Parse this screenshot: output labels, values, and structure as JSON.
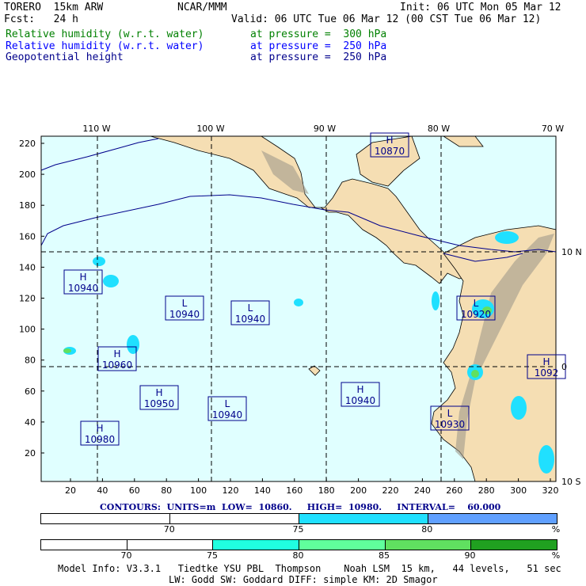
{
  "header": {
    "model": "TORERO  15km ARW",
    "org": "NCAR/MMM",
    "init": "Init: 06 UTC Mon 05 Mar 12",
    "fcst": "Fcst:   24 h",
    "valid": "Valid: 06 UTC Tue 06 Mar 12 (00 CST Tue 06 Mar 12)",
    "fields": [
      {
        "name": "Relative humidity (w.r.t. water)",
        "level": "at pressure =  300 hPa",
        "color": "#008000"
      },
      {
        "name": "Relative humidity (w.r.t. water)",
        "level": "at pressure =  250 hPa",
        "color": "#0000ff"
      },
      {
        "name": "Geopotential height",
        "level": "at pressure =  250 hPa",
        "color": "#00008b"
      }
    ]
  },
  "map": {
    "top_lon_labels": [
      "110 W",
      "100 W",
      "90 W",
      "80 W",
      "70 W"
    ],
    "right_lat_labels": [
      "10 N",
      "0",
      "10 S"
    ],
    "y_ticks": [
      "220",
      "200",
      "180",
      "160",
      "140",
      "120",
      "100",
      "80",
      "60",
      "40",
      "20"
    ],
    "x_ticks": [
      "20",
      "40",
      "60",
      "80",
      "100",
      "120",
      "140",
      "160",
      "180",
      "200",
      "220",
      "240",
      "260",
      "280",
      "300",
      "320"
    ],
    "centers": [
      {
        "type": "H",
        "value": "10940"
      },
      {
        "type": "L",
        "value": "10940"
      },
      {
        "type": "L",
        "value": "10940"
      },
      {
        "type": "H",
        "value": "10960"
      },
      {
        "type": "H",
        "value": "10950"
      },
      {
        "type": "L",
        "value": "10940"
      },
      {
        "type": "H",
        "value": "10940"
      },
      {
        "type": "H",
        "value": "10980"
      },
      {
        "type": "L",
        "value": "10930"
      },
      {
        "type": "L",
        "value": "10920"
      },
      {
        "type": "H",
        "value": "10870"
      },
      {
        "type": "H",
        "value": "1092"
      }
    ],
    "colors": {
      "ocean": "#e0ffff",
      "land": "#f5deb3",
      "contour": "#00008b"
    }
  },
  "contours_info": {
    "label": "CONTOURS:  UNITS=m  LOW=  10860.     HIGH=  10980.     INTERVAL=    60.000"
  },
  "colorbar1": {
    "ticks": [
      "70",
      "75",
      "80",
      "%"
    ],
    "colors": [
      "#ffffff",
      "#ffffff",
      "#20e0ff",
      "#60a0ff"
    ]
  },
  "colorbar2": {
    "ticks": [
      "70",
      "75",
      "80",
      "85",
      "90",
      "%"
    ],
    "colors": [
      "#ffffff",
      "#ffffff",
      "#20ffe0",
      "#60ff9c",
      "#60e060",
      "#20a020"
    ]
  },
  "footer": {
    "line1": "Model Info: V3.3.1   Tiedtke YSU PBL  Thompson    Noah LSM  15 km,   44 levels,   51 sec",
    "line2": "LW: Godd SW: Goddard DIFF: simple KM: 2D Smagor"
  }
}
